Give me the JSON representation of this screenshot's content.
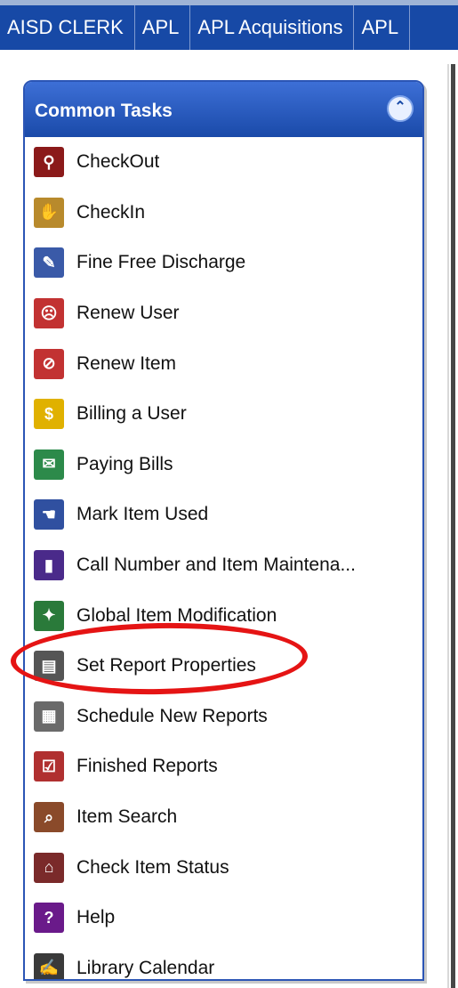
{
  "tabs": [
    {
      "label": "AISD CLERK"
    },
    {
      "label": "APL"
    },
    {
      "label": "APL Acquisitions"
    },
    {
      "label": "APL"
    }
  ],
  "panel": {
    "title": "Common Tasks",
    "collapse_icon": "chevron-double-up-icon"
  },
  "tasks": [
    {
      "label": "CheckOut",
      "icon": "stamp-icon",
      "color": "#8b1a1a"
    },
    {
      "label": "CheckIn",
      "icon": "book-hand-icon",
      "color": "#b88a2c"
    },
    {
      "label": "Fine Free Discharge",
      "icon": "discharge-icon",
      "color": "#3a5aa8"
    },
    {
      "label": "Renew User",
      "icon": "renew-user-icon",
      "color": "#c23232"
    },
    {
      "label": "Renew Item",
      "icon": "renew-item-icon",
      "color": "#c23232"
    },
    {
      "label": "Billing a User",
      "icon": "coins-user-icon",
      "color": "#e0b100"
    },
    {
      "label": "Paying Bills",
      "icon": "bill-hand-icon",
      "color": "#2c8a4a"
    },
    {
      "label": "Mark Item Used",
      "icon": "hand-book-icon",
      "color": "#3050a0"
    },
    {
      "label": "Call Number and Item Maintena...",
      "icon": "books-icon",
      "color": "#4a2a8a"
    },
    {
      "label": "Global Item Modification",
      "icon": "global-modify-icon",
      "color": "#2a7a3a"
    },
    {
      "label": "Set Report Properties",
      "icon": "report-properties-icon",
      "color": "#555555"
    },
    {
      "label": "Schedule New Reports",
      "icon": "schedule-report-icon",
      "color": "#6a6a6a"
    },
    {
      "label": "Finished Reports",
      "icon": "finished-report-icon",
      "color": "#b03030"
    },
    {
      "label": "Item Search",
      "icon": "item-search-icon",
      "color": "#8a4a2a"
    },
    {
      "label": "Check Item Status",
      "icon": "item-status-icon",
      "color": "#7a2a2a"
    },
    {
      "label": "Help",
      "icon": "help-icon",
      "color": "#6a1a8a"
    },
    {
      "label": "Library Calendar",
      "icon": "calendar-icon",
      "color": "#3a3a3a"
    }
  ]
}
